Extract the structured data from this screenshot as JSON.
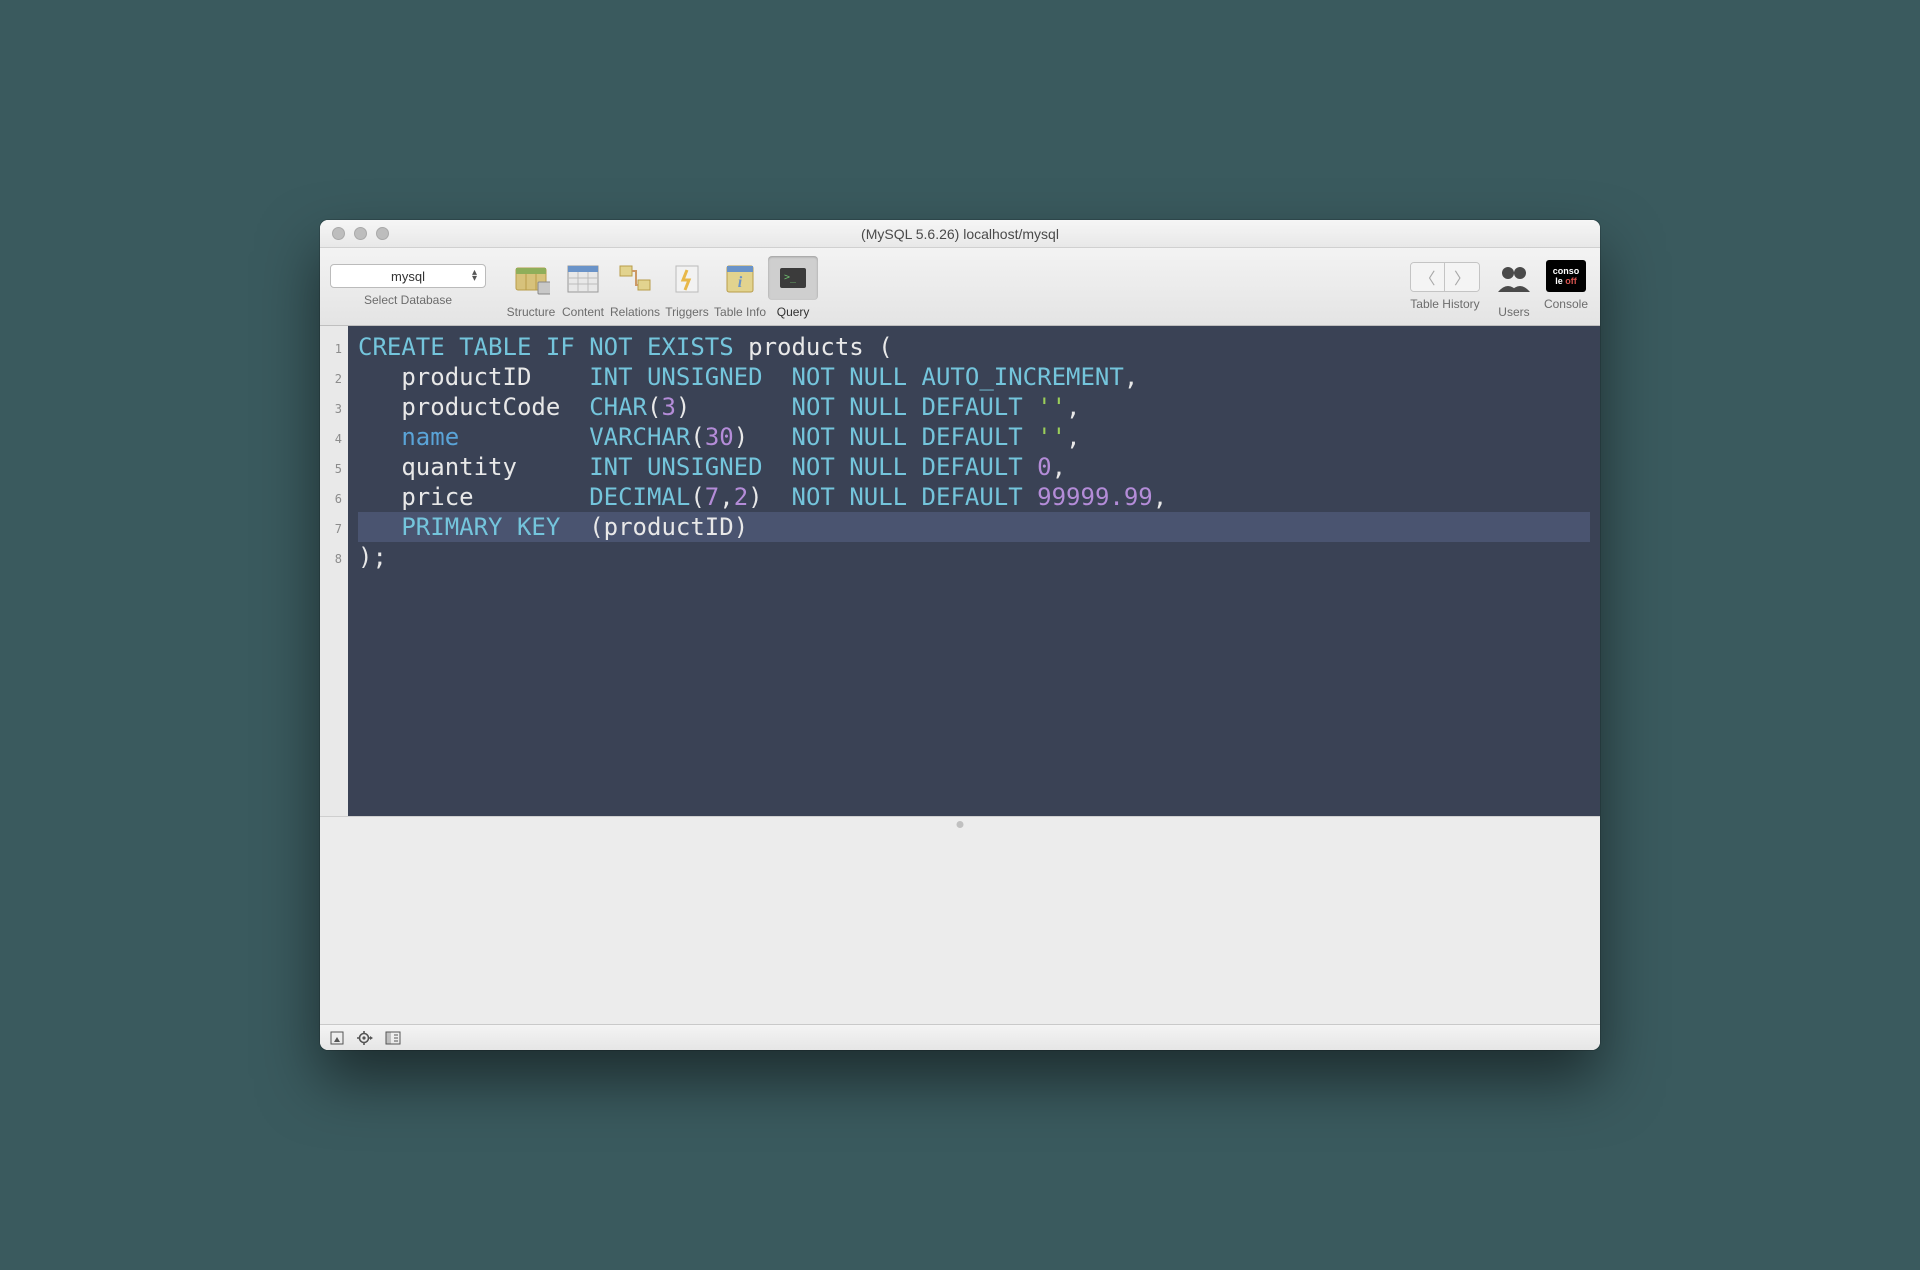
{
  "window": {
    "title": "(MySQL 5.6.26) localhost/mysql"
  },
  "toolbar": {
    "select_database": {
      "value": "mysql",
      "label": "Select Database"
    },
    "items": [
      {
        "id": "structure",
        "label": "Structure",
        "enabled": false
      },
      {
        "id": "content",
        "label": "Content",
        "enabled": false
      },
      {
        "id": "relations",
        "label": "Relations",
        "enabled": false
      },
      {
        "id": "triggers",
        "label": "Triggers",
        "enabled": false
      },
      {
        "id": "tableinfo",
        "label": "Table Info",
        "enabled": false
      },
      {
        "id": "query",
        "label": "Query",
        "enabled": true,
        "active": true
      }
    ],
    "right": {
      "table_history": "Table History",
      "users": "Users",
      "console": "Console",
      "console_badge_top": "conso",
      "console_badge_bottom": "le off"
    }
  },
  "editor": {
    "line_numbers": [
      "1",
      "2",
      "3",
      "4",
      "5",
      "6",
      "7",
      "8"
    ],
    "sql": {
      "raw": "CREATE TABLE IF NOT EXISTS products (\n   productID    INT UNSIGNED  NOT NULL AUTO_INCREMENT,\n   productCode  CHAR(3)       NOT NULL DEFAULT '',\n   name         VARCHAR(30)   NOT NULL DEFAULT '',\n   quantity     INT UNSIGNED  NOT NULL DEFAULT 0,\n   price        DECIMAL(7,2)  NOT NULL DEFAULT 99999.99,\n   PRIMARY KEY  (productID)\n);",
      "tokens": [
        [
          {
            "t": "CREATE TABLE IF NOT EXISTS",
            "c": "kw"
          },
          {
            "t": " products ",
            "c": "ident"
          },
          {
            "t": "(",
            "c": "punc"
          }
        ],
        [
          {
            "t": "   productID    ",
            "c": "ident"
          },
          {
            "t": "INT UNSIGNED",
            "c": "kw"
          },
          {
            "t": "  ",
            "c": "ident"
          },
          {
            "t": "NOT NULL AUTO_INCREMENT",
            "c": "kw"
          },
          {
            "t": ",",
            "c": "punc"
          }
        ],
        [
          {
            "t": "   productCode  ",
            "c": "ident"
          },
          {
            "t": "CHAR",
            "c": "kw"
          },
          {
            "t": "(",
            "c": "punc"
          },
          {
            "t": "3",
            "c": "num"
          },
          {
            "t": ")",
            "c": "punc"
          },
          {
            "t": "       ",
            "c": "ident"
          },
          {
            "t": "NOT NULL DEFAULT",
            "c": "kw"
          },
          {
            "t": " ",
            "c": "ident"
          },
          {
            "t": "''",
            "c": "str"
          },
          {
            "t": ",",
            "c": "punc"
          }
        ],
        [
          {
            "t": "   ",
            "c": "ident"
          },
          {
            "t": "name",
            "c": "blue"
          },
          {
            "t": "         ",
            "c": "ident"
          },
          {
            "t": "VARCHAR",
            "c": "kw"
          },
          {
            "t": "(",
            "c": "punc"
          },
          {
            "t": "30",
            "c": "num"
          },
          {
            "t": ")",
            "c": "punc"
          },
          {
            "t": "   ",
            "c": "ident"
          },
          {
            "t": "NOT NULL DEFAULT",
            "c": "kw"
          },
          {
            "t": " ",
            "c": "ident"
          },
          {
            "t": "''",
            "c": "str"
          },
          {
            "t": ",",
            "c": "punc"
          }
        ],
        [
          {
            "t": "   quantity     ",
            "c": "ident"
          },
          {
            "t": "INT UNSIGNED",
            "c": "kw"
          },
          {
            "t": "  ",
            "c": "ident"
          },
          {
            "t": "NOT NULL DEFAULT",
            "c": "kw"
          },
          {
            "t": " ",
            "c": "ident"
          },
          {
            "t": "0",
            "c": "num"
          },
          {
            "t": ",",
            "c": "punc"
          }
        ],
        [
          {
            "t": "   price        ",
            "c": "ident"
          },
          {
            "t": "DECIMAL",
            "c": "kw"
          },
          {
            "t": "(",
            "c": "punc"
          },
          {
            "t": "7",
            "c": "num"
          },
          {
            "t": ",",
            "c": "punc"
          },
          {
            "t": "2",
            "c": "num"
          },
          {
            "t": ")",
            "c": "punc"
          },
          {
            "t": "  ",
            "c": "ident"
          },
          {
            "t": "NOT NULL DEFAULT",
            "c": "kw"
          },
          {
            "t": " ",
            "c": "ident"
          },
          {
            "t": "99999.99",
            "c": "num"
          },
          {
            "t": ",",
            "c": "punc"
          }
        ],
        [
          {
            "t": "   ",
            "c": "ident"
          },
          {
            "t": "PRIMARY KEY",
            "c": "kw"
          },
          {
            "t": "  (productID)",
            "c": "ident"
          }
        ],
        [
          {
            "t": ");",
            "c": "punc"
          }
        ]
      ],
      "cursor_line": 7
    }
  },
  "colors": {
    "editor_bg": "#3a4255",
    "keyword": "#74c5dc",
    "number": "#b48cd8",
    "string": "#9bcf5a",
    "name_blue": "#5aa4d8"
  }
}
